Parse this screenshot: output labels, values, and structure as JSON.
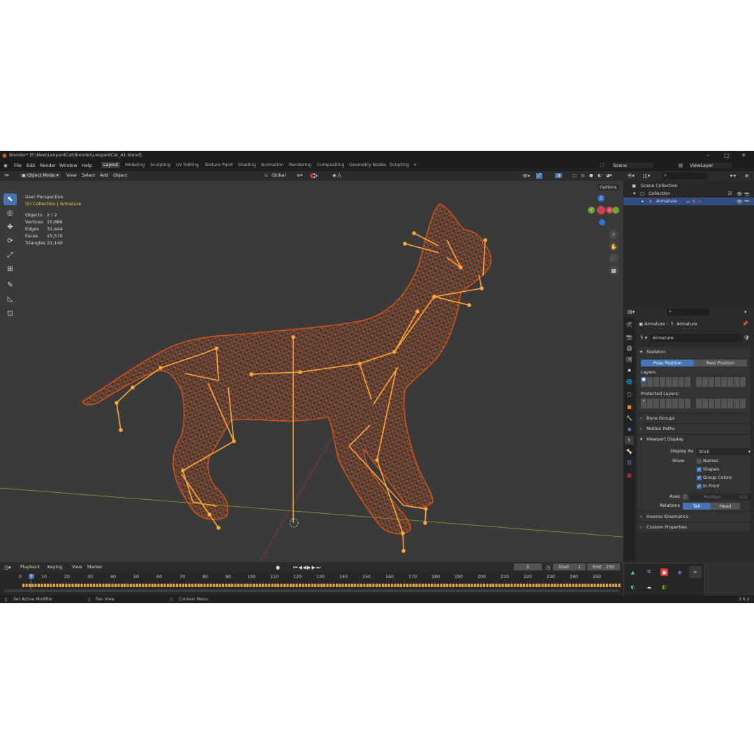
{
  "window": {
    "title": "Blender* [F:\\New\\LeopardCat\\Blender\\LeopardCat_A1.blend]"
  },
  "menu": {
    "items": [
      "File",
      "Edit",
      "Render",
      "Window",
      "Help"
    ]
  },
  "workspaces": [
    {
      "label": "Layout",
      "active": true
    },
    {
      "label": "Modeling"
    },
    {
      "label": "Sculpting"
    },
    {
      "label": "UV Editing"
    },
    {
      "label": "Texture Paint"
    },
    {
      "label": "Shading"
    },
    {
      "label": "Animation"
    },
    {
      "label": "Rendering"
    },
    {
      "label": "Compositing"
    },
    {
      "label": "Geometry Nodes"
    },
    {
      "label": "Scripting"
    }
  ],
  "scene": {
    "label": "Scene",
    "view_layer": "ViewLayer"
  },
  "viewport_header": {
    "mode": "Object Mode",
    "view": "View",
    "select": "Select",
    "add": "Add",
    "object": "Object",
    "orientation": "Global",
    "options": "Options"
  },
  "viewport_overlay": {
    "perspective": "User Perspective",
    "collection": "(5) Collection | Armature",
    "stats": [
      {
        "label": "Objects",
        "value": "2 / 2"
      },
      {
        "label": "Vertices",
        "value": "15,886"
      },
      {
        "label": "Edges",
        "value": "31,444"
      },
      {
        "label": "Faces",
        "value": "15,570"
      },
      {
        "label": "Triangles",
        "value": "31,140"
      }
    ]
  },
  "gizmo": {
    "z": "Z",
    "y": "Y",
    "x": "X"
  },
  "outliner": {
    "scene_collection": "Scene Collection",
    "collection": "Collection",
    "armature": "Armature"
  },
  "properties": {
    "breadcrumb_obj": "Armature",
    "breadcrumb_data": "Armature",
    "data_name": "Armature",
    "skeleton": {
      "title": "Skeleton",
      "pose_position": "Pose Position",
      "rest_position": "Rest Position",
      "layers": "Layers:",
      "protected_layers": "Protected Layers:"
    },
    "bone_groups": "Bone Groups",
    "motion_paths": "Motion Paths",
    "viewport_display": {
      "title": "Viewport Display",
      "display_as_label": "Display As",
      "display_as_value": "Stick",
      "show_label": "Show",
      "names": "Names",
      "shapes": "Shapes",
      "group_colors": "Group Colors",
      "in_front": "In Front",
      "axes_label": "Axes",
      "position_label": "Position",
      "position_value": "0.0",
      "relations_label": "Relations",
      "tail": "Tail",
      "head": "Head"
    },
    "inverse_kinematics": "Inverse Kinematics",
    "custom_properties": "Custom Properties"
  },
  "timeline": {
    "playback": "Playback",
    "keying": "Keying",
    "view": "View",
    "marker": "Marker",
    "current_frame": "5",
    "start_label": "Start",
    "start": "1",
    "end_label": "End",
    "end": "250",
    "ticks": [
      "0",
      "10",
      "20",
      "30",
      "40",
      "50",
      "60",
      "70",
      "80",
      "90",
      "100",
      "110",
      "120",
      "130",
      "140",
      "150",
      "160",
      "170",
      "180",
      "190",
      "200",
      "210",
      "220",
      "230",
      "240",
      "250"
    ],
    "playhead": "5"
  },
  "statusbar": {
    "left": "Set Active Modifier",
    "mid": "Pan View",
    "right": "Context Menu",
    "version": "3.6.2"
  },
  "colors": {
    "accent": "#4772b3",
    "mesh": "#d9541a",
    "bone": "#ffa53a",
    "bg": "#303030"
  }
}
